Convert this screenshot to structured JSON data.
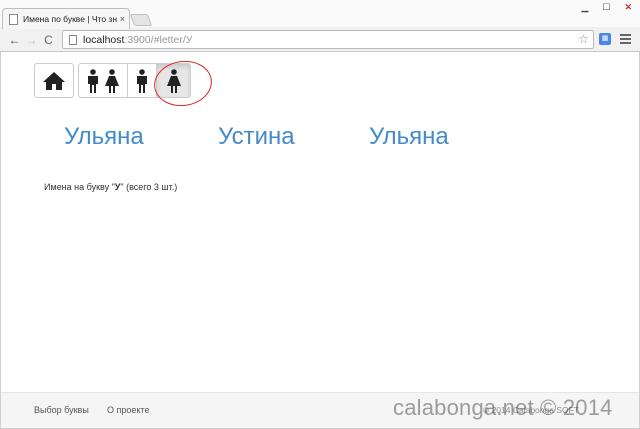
{
  "browser": {
    "tab_title": "Имена по букве | Что зна",
    "tab_close": "×",
    "window_controls": {
      "minimize": "▁",
      "maximize": "☐",
      "close": "✕"
    },
    "url_host": "localhost",
    "url_rest": ":3900/#letter/У",
    "nav": {
      "back": "←",
      "forward": "→",
      "reload": "C",
      "star": "☆"
    }
  },
  "toolbar": {
    "buttons": [
      {
        "icon": "home-icon",
        "active": false
      },
      {
        "icon": "male-female-icon",
        "active": false
      },
      {
        "icon": "male-icon",
        "active": false
      },
      {
        "icon": "female-icon",
        "active": true
      }
    ]
  },
  "names": [
    "Ульяна",
    "Устина",
    "Ульяна"
  ],
  "summary": {
    "prefix": "Имена на букву \"",
    "letter": "У",
    "suffix": "\" (всего 3 шт.)"
  },
  "footer": {
    "links": [
      "Выбор буквы",
      "О проекте"
    ],
    "copyright": "© 2014 Calabonga SOFT"
  },
  "watermark": "calabonga.net © 2014",
  "colors": {
    "link": "#428bca",
    "annotation": "#e0262c"
  }
}
